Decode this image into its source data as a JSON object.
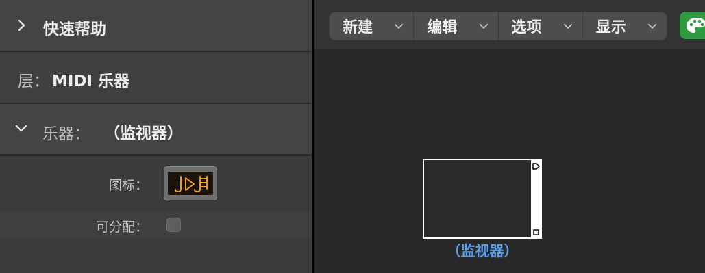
{
  "inspector": {
    "quick_help": {
      "label": "快速帮助",
      "icon": "chevron-right-icon"
    },
    "layer": {
      "label": "层：",
      "value": "MIDI 乐器"
    },
    "instrument": {
      "label": "乐器：",
      "name": "（监视器）",
      "icon": "chevron-down-icon"
    },
    "properties": {
      "icon_label": "图标：",
      "icon_value": "midi-notes-instrument-icon",
      "assignable_label": "可分配：",
      "assignable_checked": false
    }
  },
  "toolbar": {
    "menus": [
      {
        "label": "新建"
      },
      {
        "label": "编辑"
      },
      {
        "label": "选项"
      },
      {
        "label": "显示"
      }
    ],
    "palette_icon": "palette-icon",
    "accent_color": "#2e9b41"
  },
  "canvas": {
    "object": {
      "label": "（监视器）",
      "label_color": "#5d9ee6"
    }
  }
}
